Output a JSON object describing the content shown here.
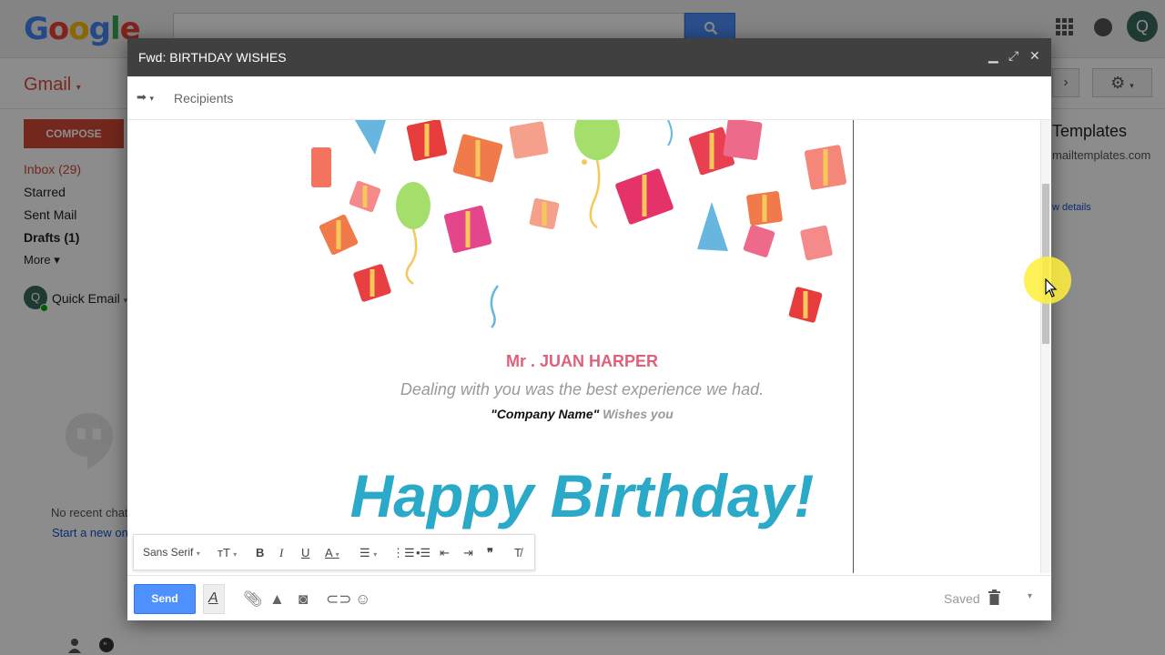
{
  "header": {
    "logo_letters": [
      "G",
      "o",
      "o",
      "g",
      "l",
      "e"
    ],
    "search_placeholder": ""
  },
  "sub": {
    "gmail_label": "Gmail",
    "gmail_caret": "▾"
  },
  "sidebar": {
    "compose_label": "COMPOSE",
    "items": [
      {
        "label": "Inbox (29)"
      },
      {
        "label": "Starred"
      },
      {
        "label": "Sent Mail"
      },
      {
        "label": "Drafts (1)"
      },
      {
        "label": "More ▾"
      }
    ],
    "quick_email": "Quick Email",
    "avatar_letter": "Q",
    "no_chats": "No recent chats",
    "start_chat": "Start a new one"
  },
  "right_panel": {
    "title": "Templates",
    "sub": "mailtemplates.com",
    "link": "w details"
  },
  "compose": {
    "title": "Fwd: BIRTHDAY WISHES",
    "recipients_placeholder": "Recipients",
    "send_label": "Send",
    "saved_label": "Saved",
    "format": {
      "font": "Sans Serif"
    }
  },
  "email": {
    "recipient_name": "Mr . JUAN HARPER",
    "greeting": "Dealing with you was the best experience we had.",
    "company_name": "Company Name",
    "wishes_suffix": " Wishes you",
    "headline": "Happy Birthday!"
  },
  "colors": {
    "accent_red": "#d14836",
    "send_blue": "#4d90fe",
    "headline_blue": "#2ba9c8",
    "name_pink": "#e0607a"
  }
}
